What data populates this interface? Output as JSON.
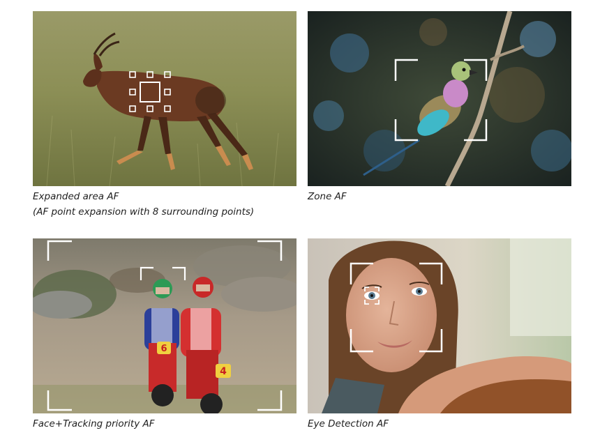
{
  "panels": [
    {
      "id": "expanded-area-af",
      "caption_line1": "Expanded area AF",
      "caption_line2": "(AF point expansion with 8 surrounding points)"
    },
    {
      "id": "zone-af",
      "caption_line1": "Zone AF"
    },
    {
      "id": "face-tracking-priority-af",
      "caption_line1": "Face+Tracking priority AF",
      "bike_numbers": [
        "6",
        "4"
      ]
    },
    {
      "id": "eye-detection-af",
      "caption_line1": "Eye Detection AF"
    }
  ],
  "colors": {
    "af_frame": "#ffffff",
    "caption_text": "#1e1e1e",
    "grass": "#8a8f52",
    "bokeh_bg": "#2c3a2e",
    "dirt": "#a89b86",
    "skin": "#d9a88c"
  }
}
